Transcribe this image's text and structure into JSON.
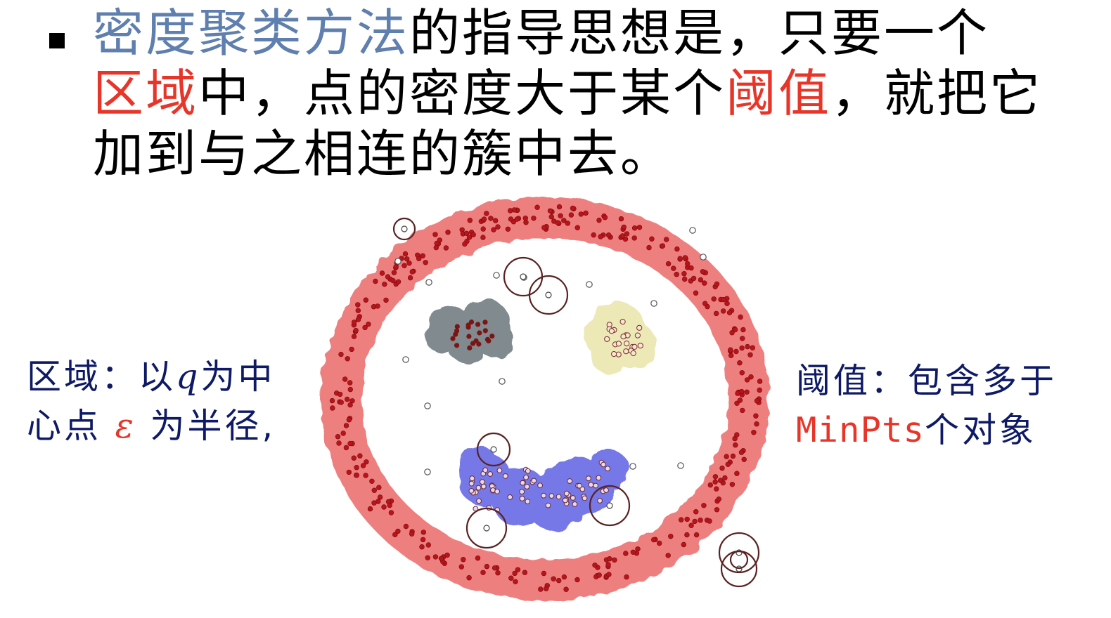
{
  "bullet": {
    "part1": "密度聚类方法",
    "part2": "的指导思想是，只要一个",
    "part3": "区域",
    "part4": "中，点的密度大于某个",
    "part5": "阈值",
    "part6": "，就把它加到与之相连的簇中去。"
  },
  "left_note": {
    "line1_a": "区域：以",
    "line1_q": "q",
    "line1_b": "为中",
    "line2_a": "心点 ",
    "line2_eps": "ε",
    "line2_b": " 为半径,"
  },
  "right_note": {
    "line1": "阈值：包含多于",
    "minpts": "MinPts",
    "line2_b": "个对象"
  },
  "colors": {
    "ring_halo": "#ee7f7f",
    "ring_point": "#b8141c",
    "gray_cluster": "#818b8f",
    "gray_point": "#7a1515",
    "yellow_cluster": "#ece9b6",
    "blue_cluster": "#7478e6",
    "noise_point": "#ffffff",
    "circle_stroke": "#5a2222"
  },
  "icons": [
    "square-bullet-icon"
  ]
}
